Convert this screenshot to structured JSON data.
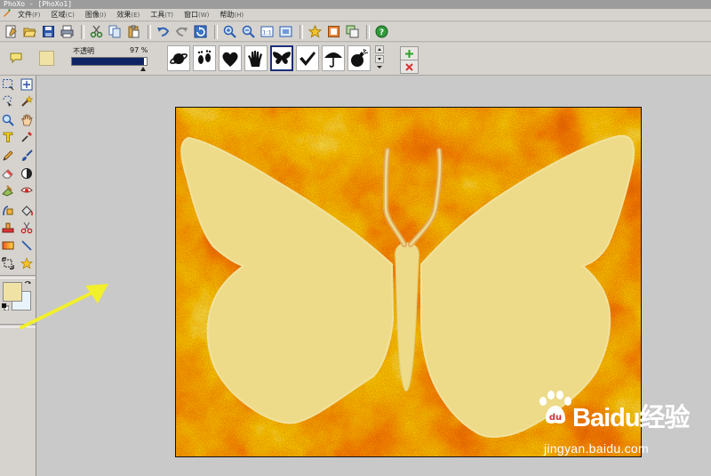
{
  "window": {
    "title": "PhoXo - [PhoXo1]"
  },
  "menu": [
    {
      "label": "文件",
      "key": "(F)"
    },
    {
      "label": "区域",
      "key": "(C)"
    },
    {
      "label": "图像",
      "key": "(I)"
    },
    {
      "label": "效果",
      "key": "(E)"
    },
    {
      "label": "工具",
      "key": "(T)"
    },
    {
      "label": "窗口",
      "key": "(W)"
    },
    {
      "label": "帮助",
      "key": "(H)"
    }
  ],
  "toolbar": {
    "buttons": [
      "new-icon",
      "open-icon",
      "save-icon",
      "print-icon",
      "cut-icon",
      "copy-icon",
      "paste-icon",
      "undo-icon",
      "redo-icon",
      "refresh-icon",
      "zoom-in-icon",
      "zoom-out-icon",
      "actual-size-icon",
      "fit-window-icon",
      "favorite-star-icon",
      "frame-icon",
      "layer-icon",
      "help-icon"
    ]
  },
  "shape_options": {
    "opacity_label": "不透明",
    "opacity_value": "97 %",
    "opacity_fraction": 0.97,
    "fill_color": "#f0e2a4",
    "shapes": [
      "planet-icon",
      "footprint-icon",
      "heart-icon",
      "hand-icon",
      "butterfly-icon",
      "check-mark-icon",
      "umbrella-icon",
      "bomb-icon"
    ],
    "selected_shape": "butterfly-icon"
  },
  "toolbox": {
    "tools": [
      "rect-select-icon",
      "move-icon",
      "lasso-icon",
      "magic-wand-icon",
      "zoom-tool-icon",
      "hand-tool-icon",
      "text-tool-icon",
      "eyedropper-icon",
      "pencil-icon",
      "brush-icon",
      "eraser-icon",
      "contrast-icon",
      "smudge-icon",
      "red-eye-icon",
      "clone-icon",
      "paint-bucket-icon",
      "stamp-icon",
      "scissors-icon",
      "gradient-icon",
      "line-icon",
      "crop-transform-icon",
      "star-shape-icon"
    ],
    "foreground_color": "#f0e2a4",
    "background_color": "#e8f4fa"
  },
  "canvas": {
    "background": "fire-cloud-texture",
    "shape": "butterfly",
    "shape_color": "#eddb8a"
  },
  "watermark": {
    "brand": "Baidu经验",
    "url": "jingyan.baidu.com"
  },
  "annotation": {
    "color": "#f2ef2c"
  }
}
